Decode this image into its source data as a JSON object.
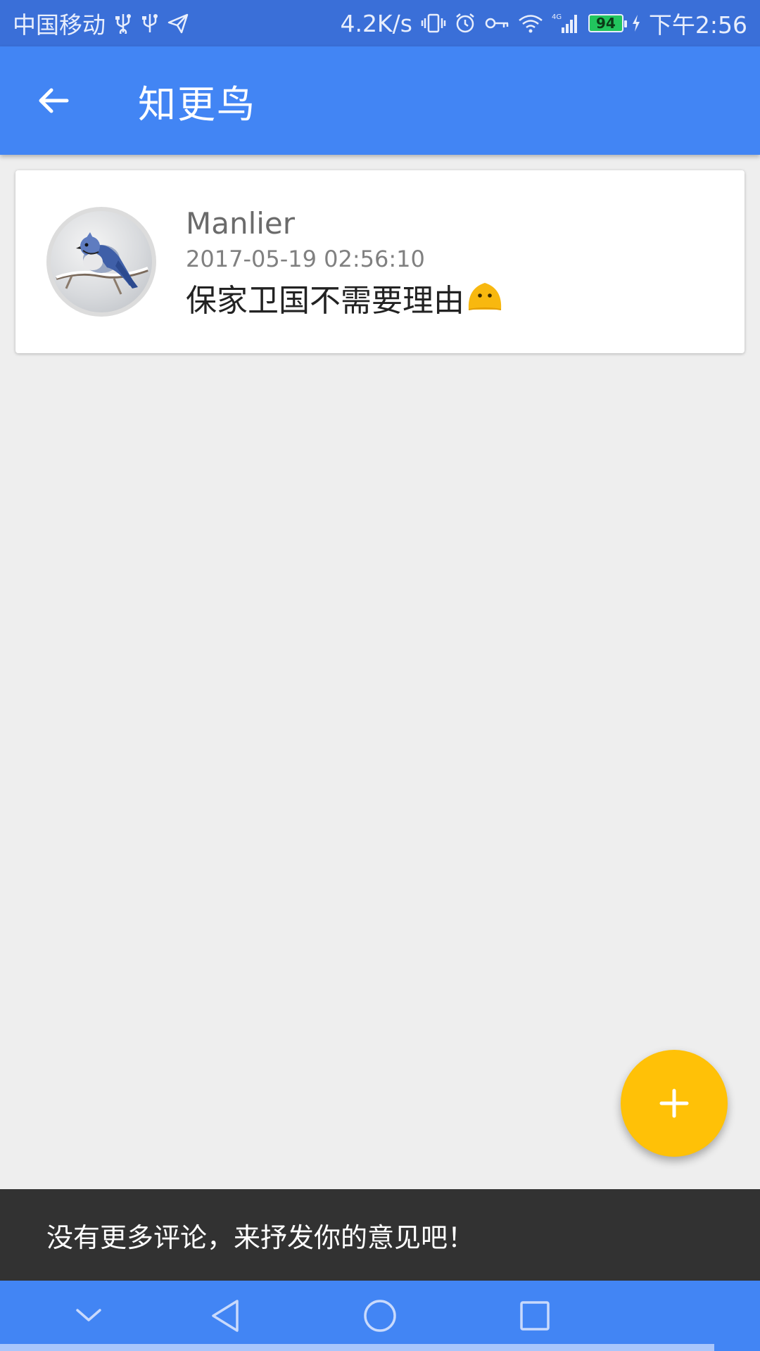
{
  "status_bar": {
    "carrier": "中国移动",
    "speed": "4.2K/s",
    "network": "4G",
    "battery": "94",
    "time": "下午2:56"
  },
  "app_bar": {
    "title": "知更鸟",
    "back_icon": "arrow-left-icon"
  },
  "comments": [
    {
      "author": "Manlier",
      "time": "2017-05-19 02:56:10",
      "text": "保家卫国不需要理由",
      "emoji": "blob-face-emoji"
    }
  ],
  "fab": {
    "icon": "plus-icon"
  },
  "snackbar": {
    "message": "没有更多评论，来抒发你的意见吧！"
  },
  "nav_bar": {
    "buttons": [
      "chevron-down-icon",
      "back-triangle-icon",
      "home-circle-icon",
      "recents-square-icon"
    ]
  },
  "colors": {
    "primary": "#4285f4",
    "status_bar": "#3a6fd8",
    "accent": "#ffc107",
    "snackbar": "#323232",
    "background": "#eeeeee"
  }
}
